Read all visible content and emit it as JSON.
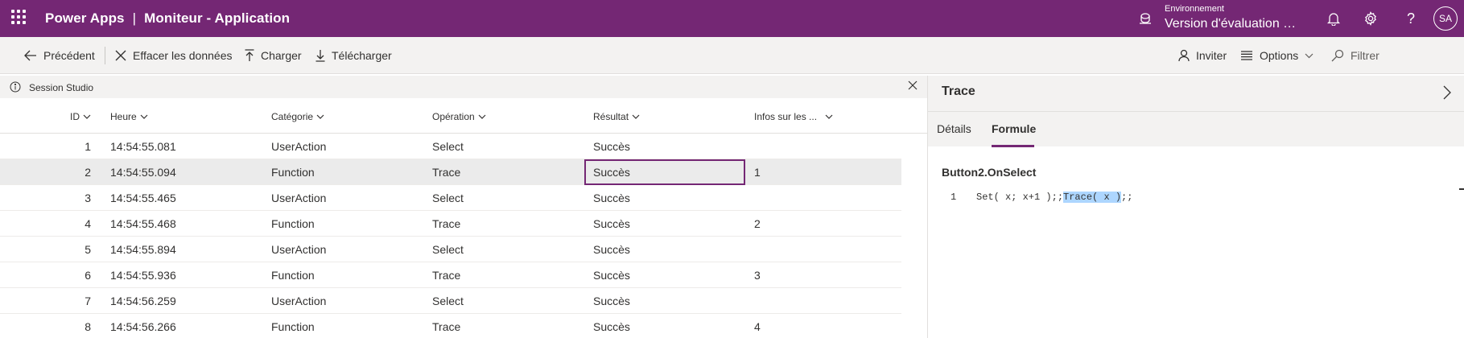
{
  "topbar": {
    "app_name": "Power Apps",
    "separator": "|",
    "page_title": "Moniteur - Application",
    "environment_label": "Environnement",
    "environment_name": "Version d'évaluation de...",
    "user_initials": "SA",
    "background_color": "#742774",
    "icons": [
      "waffle-icon",
      "environment-icon",
      "bell-icon",
      "gear-icon",
      "help-icon"
    ]
  },
  "commands": {
    "back_label": "Précédent",
    "clear_label": "Effacer les données",
    "upload_label": "Charger",
    "download_label": "Télécharger",
    "invite_label": "Inviter",
    "options_label": "Options",
    "filter_label": "Filtrer"
  },
  "session": {
    "label": "Session Studio"
  },
  "table": {
    "columns": [
      {
        "key": "id",
        "label": "ID"
      },
      {
        "key": "time",
        "label": "Heure"
      },
      {
        "key": "category",
        "label": "Catégorie"
      },
      {
        "key": "operation",
        "label": "Opération"
      },
      {
        "key": "result",
        "label": "Résultat"
      },
      {
        "key": "info",
        "label": "Infos sur les ..."
      }
    ],
    "rows": [
      {
        "id": "1",
        "time": "14:54:55.081",
        "category": "UserAction",
        "operation": "Select",
        "result": "Succès",
        "info": ""
      },
      {
        "id": "2",
        "time": "14:54:55.094",
        "category": "Function",
        "operation": "Trace",
        "result": "Succès",
        "info": "1"
      },
      {
        "id": "3",
        "time": "14:54:55.465",
        "category": "UserAction",
        "operation": "Select",
        "result": "Succès",
        "info": ""
      },
      {
        "id": "4",
        "time": "14:54:55.468",
        "category": "Function",
        "operation": "Trace",
        "result": "Succès",
        "info": "2"
      },
      {
        "id": "5",
        "time": "14:54:55.894",
        "category": "UserAction",
        "operation": "Select",
        "result": "Succès",
        "info": ""
      },
      {
        "id": "6",
        "time": "14:54:55.936",
        "category": "Function",
        "operation": "Trace",
        "result": "Succès",
        "info": "3"
      },
      {
        "id": "7",
        "time": "14:54:56.259",
        "category": "UserAction",
        "operation": "Select",
        "result": "Succès",
        "info": ""
      },
      {
        "id": "8",
        "time": "14:54:56.266",
        "category": "Function",
        "operation": "Trace",
        "result": "Succès",
        "info": "4"
      }
    ],
    "selected_row_id": "2",
    "focused_column": "result"
  },
  "panel": {
    "title": "Trace",
    "tabs": [
      {
        "label": "Détails",
        "active": false
      },
      {
        "label": "Formule",
        "active": true
      }
    ],
    "formula_name": "Button2.OnSelect",
    "code": {
      "line_number": "1",
      "before": "Set( x; x+1 );;",
      "highlight": "Trace( x )",
      "after": ";;"
    }
  }
}
